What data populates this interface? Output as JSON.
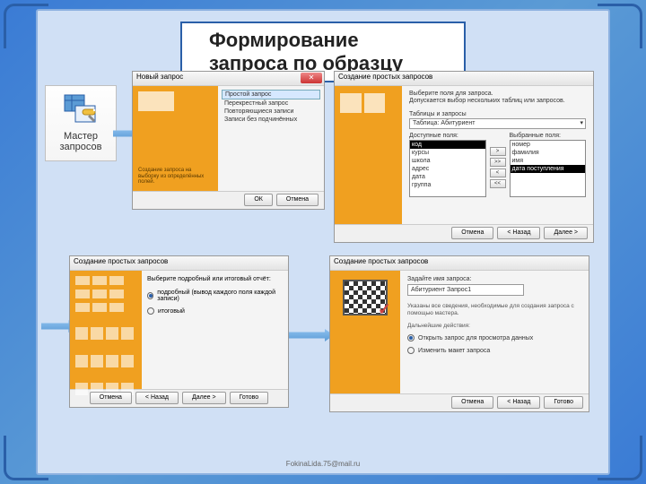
{
  "title": "Формирование запроса по образцу",
  "ribbon": {
    "label_line1": "Мастер",
    "label_line2": "запросов"
  },
  "arrows": [
    "a1",
    "a2",
    "a3"
  ],
  "dialog1": {
    "titlebar": "Новый запрос",
    "options": [
      "Простой запрос",
      "Перекрестный запрос",
      "Повторяющиеся записи",
      "Записи без подчинённых"
    ],
    "desc": "Создание запроса на выборку из определённых полей.",
    "btn_ok": "ОК",
    "btn_cancel": "Отмена"
  },
  "dialog2": {
    "titlebar": "Создание простых запросов",
    "intro1": "Выберите поля для запроса.",
    "intro2": "Допускается выбор нескольких таблиц или запросов.",
    "label_tables": "Таблицы и запросы",
    "dropdown_value": "Таблица: Абитуриент",
    "label_avail": "Доступные поля:",
    "label_sel": "Выбранные поля:",
    "available": [
      "код",
      "курсы",
      "школа",
      "адрес",
      "дата",
      "группа"
    ],
    "selected": [
      "номер",
      "фамилия",
      "имя",
      "дата поступления"
    ],
    "movers": [
      ">",
      ">>",
      "<",
      "<<"
    ],
    "btn_cancel": "Отмена",
    "btn_back": "< Назад",
    "btn_next": "Далее >"
  },
  "dialog3": {
    "titlebar": "Создание простых запросов",
    "prompt": "Выберите подробный или итоговый отчёт:",
    "radio1": "подробный (вывод каждого поля каждой записи)",
    "radio2": "итоговый",
    "btn_cancel": "Отмена",
    "btn_back": "< Назад",
    "btn_next": "Далее >",
    "btn_finish": "Готово"
  },
  "dialog4": {
    "titlebar": "Создание простых запросов",
    "label_name": "Задайте имя запроса:",
    "name_value": "Абитуриент Запрос1",
    "para1": "Указаны все сведения, необходимые для создания запроса с помощью мастера.",
    "para2": "Дальнейшие действия:",
    "radio1": "Открыть запрос для просмотра данных",
    "radio2": "Изменить макет запроса",
    "btn_cancel": "Отмена",
    "btn_back": "< Назад",
    "btn_finish": "Готово"
  },
  "footer": "FokinaLida.75@mail.ru"
}
